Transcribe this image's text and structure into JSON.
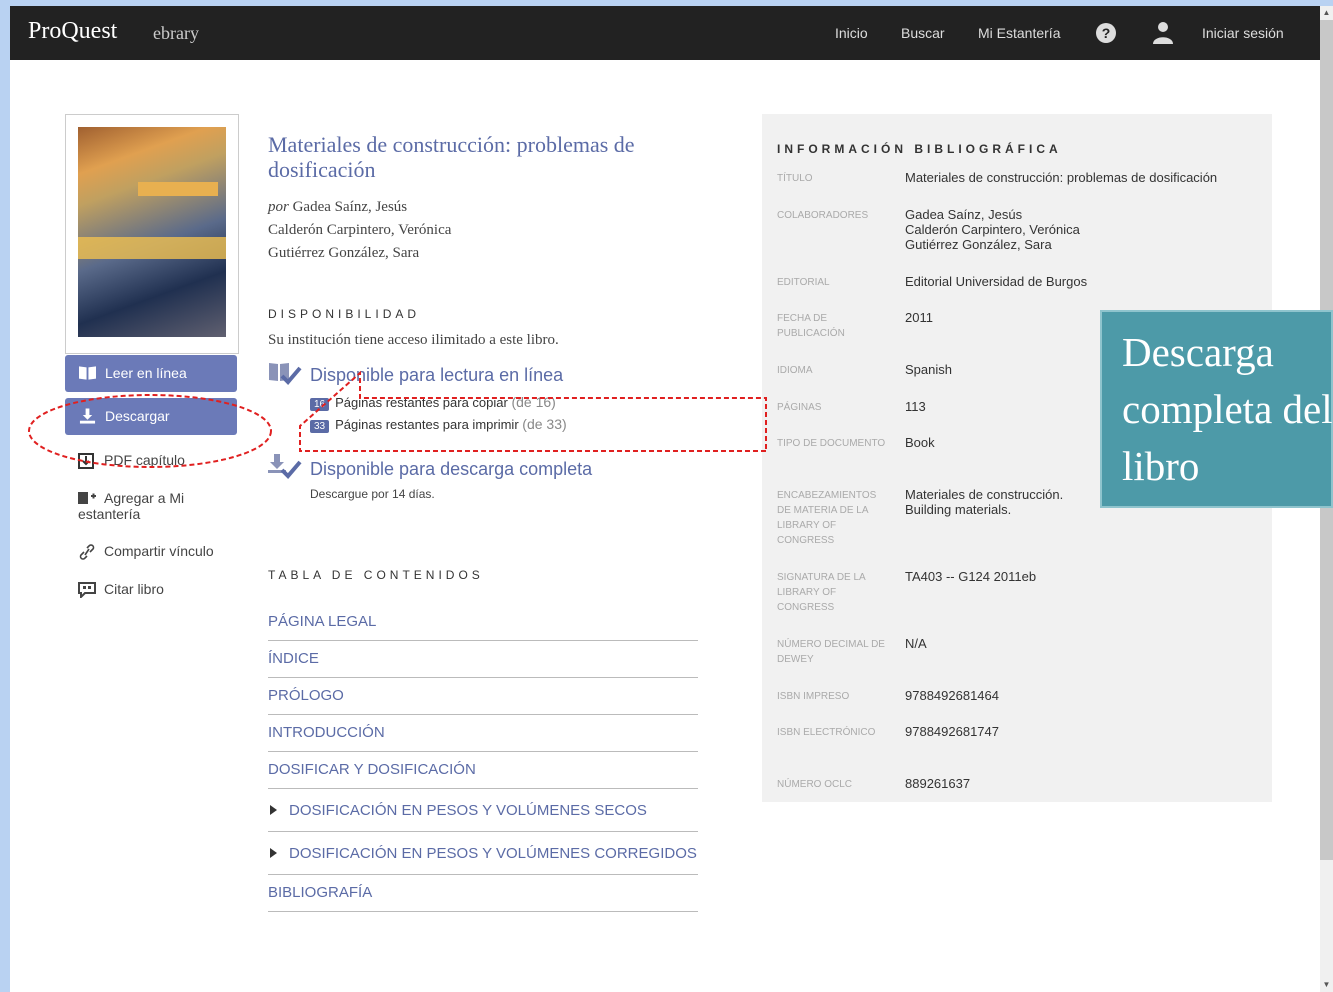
{
  "header": {
    "logo": "ProQuest",
    "logo_sub": "ebrary",
    "nav": [
      "Inicio",
      "Buscar",
      "Mi Estantería"
    ],
    "help": "?",
    "login": "Iniciar sesión"
  },
  "sidebar": {
    "read_online": "Leer en línea",
    "download": "Descargar",
    "pdf_chapter": "PDF capítulo",
    "add_shelf_line1": "Agregar a Mi",
    "add_shelf_line2": "estantería",
    "share_link": "Compartir vínculo",
    "cite_book": "Citar libro"
  },
  "book": {
    "title": "Materiales de construcción: problemas de dosificación",
    "by": "por",
    "authors": [
      "Gadea Saínz, Jesús",
      "Calderón Carpintero, Verónica",
      "Gutiérrez González, Sara"
    ]
  },
  "availability": {
    "heading": "DISPONIBILIDAD",
    "access": "Su institución tiene acceso ilimitado a este libro.",
    "online_heading": "Disponible para lectura en línea",
    "copy_badge": "16",
    "copy_text": "Páginas restantes para copiar",
    "copy_of": "(de 16)",
    "print_badge": "33",
    "print_text": "Páginas restantes para imprimir",
    "print_of": "(de 33)",
    "download_heading": "Disponible para descarga completa",
    "download_note": "Descargue por 14 días."
  },
  "toc": {
    "heading": "TABLA DE CONTENIDOS",
    "items": [
      "PÁGINA LEGAL",
      "ÍNDICE",
      "PRÓLOGO",
      "INTRODUCCIÓN",
      "DOSIFICAR Y DOSIFICACIÓN",
      "DOSIFICACIÓN EN PESOS Y VOLÚMENES SECOS",
      "DOSIFICACIÓN EN PESOS Y VOLÚMENES CORREGIDOS",
      "BIBLIOGRAFÍA"
    ]
  },
  "biblio": {
    "heading": "INFORMACIÓN BIBLIOGRÁFICA",
    "rows": [
      {
        "label": "TÍTULO",
        "value": "Materiales de construcción: problemas de dosificación"
      },
      {
        "label": "COLABORADORES",
        "value": "Gadea Saínz, Jesús\nCalderón Carpintero, Verónica\nGutiérrez González, Sara"
      },
      {
        "label": "EDITORIAL",
        "value": "Editorial Universidad de Burgos"
      },
      {
        "label": "FECHA DE PUBLICACIÓN",
        "value": "2011"
      },
      {
        "label": "IDIOMA",
        "value": "Spanish"
      },
      {
        "label": "PÁGINAS",
        "value": "113"
      },
      {
        "label": "TIPO DE DOCUMENTO",
        "value": "Book"
      },
      {
        "label": "ENCABEZAMIENTOS DE MATERIA DE LA LIBRARY OF CONGRESS",
        "value": "Materiales de construcción.\nBuilding materials."
      },
      {
        "label": "SIGNATURA DE LA LIBRARY OF CONGRESS",
        "value": "TA403 -- G124 2011eb"
      },
      {
        "label": "NÚMERO DECIMAL DE DEWEY",
        "value": "N/A"
      },
      {
        "label": "ISBN IMPRESO",
        "value": "9788492681464"
      },
      {
        "label": "ISBN ELECTRÓNICO",
        "value": "9788492681747"
      },
      {
        "label": "NÚMERO OCLC",
        "value": "889261637"
      }
    ]
  },
  "callout": {
    "text": "Descarga\ncompleta del\nlibro"
  },
  "colors": {
    "accent": "#5b6ba6",
    "button": "#6b7ab8",
    "topbar": "#222222",
    "callout": "#4d9aa8",
    "annotation": "#e02020"
  }
}
